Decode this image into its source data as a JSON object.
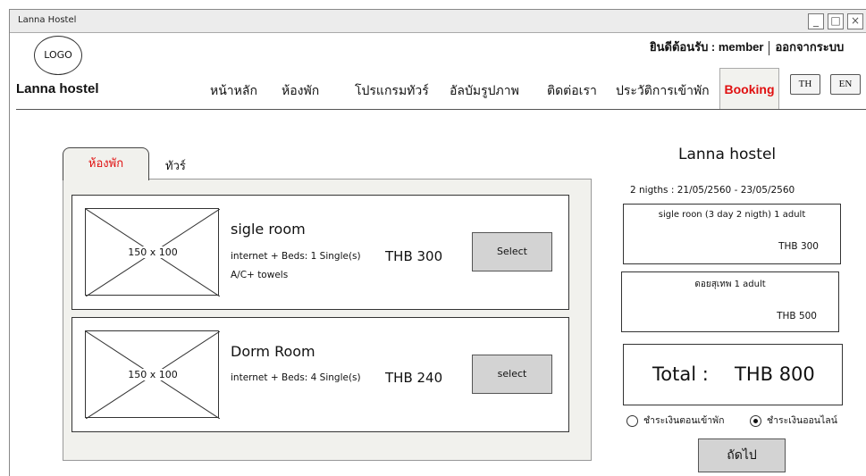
{
  "window": {
    "title": "Lanna Hostel",
    "minimize_icon": "_",
    "maximize_icon": "□",
    "close_icon": "×"
  },
  "header": {
    "logo_text": "LOGO",
    "brand": "Lanna hostel",
    "welcome": "ยินดีต้อนรับ : member",
    "logout": "ออกจากระบบ",
    "nav": [
      "หน้าหลัก",
      "ห้องพัก",
      "โปรแกรมทัวร์",
      "อัลบัมรูปภาพ",
      "ติดต่อเรา",
      "ประวัติการเข้าพัก"
    ],
    "nav_active": "Booking",
    "lang": [
      "TH",
      "EN"
    ]
  },
  "tabs": {
    "active": "ห้องพัก",
    "inactive": "ทัวร์"
  },
  "rooms": [
    {
      "thumb": "150 x 100",
      "name": "sigle room",
      "desc1": "internet + Beds: 1 Single(s)",
      "desc2": "A/C+ towels",
      "price": "THB  300",
      "button": "Select"
    },
    {
      "thumb": "150 x 100",
      "name": "Dorm Room",
      "desc1": "internet +  Beds: 4 Single(s)",
      "desc2": "",
      "price": "THB  240",
      "button": "select"
    }
  ],
  "summary": {
    "title": "Lanna hostel",
    "dates": "2 nigths : 21/05/2560  -  23/05/2560",
    "items": [
      {
        "label": "sigle roon (3 day 2 nigth) 1 adult",
        "price": "THB  300"
      },
      {
        "label": "ดอยสุเทพ 1 adult",
        "price": "THB  500"
      }
    ],
    "total_label": "Total :",
    "total_value": "THB  800",
    "payment_options": [
      {
        "label": "ชำระเงินตอนเข้าพัก",
        "selected": false
      },
      {
        "label": "ชำระเงินออนไลน์",
        "selected": true
      }
    ],
    "next_label": "ถัดไป"
  },
  "colors": {
    "accent": "#e01010",
    "panel_bg": "#f1f1ed",
    "button_bg": "#d3d3d3"
  }
}
